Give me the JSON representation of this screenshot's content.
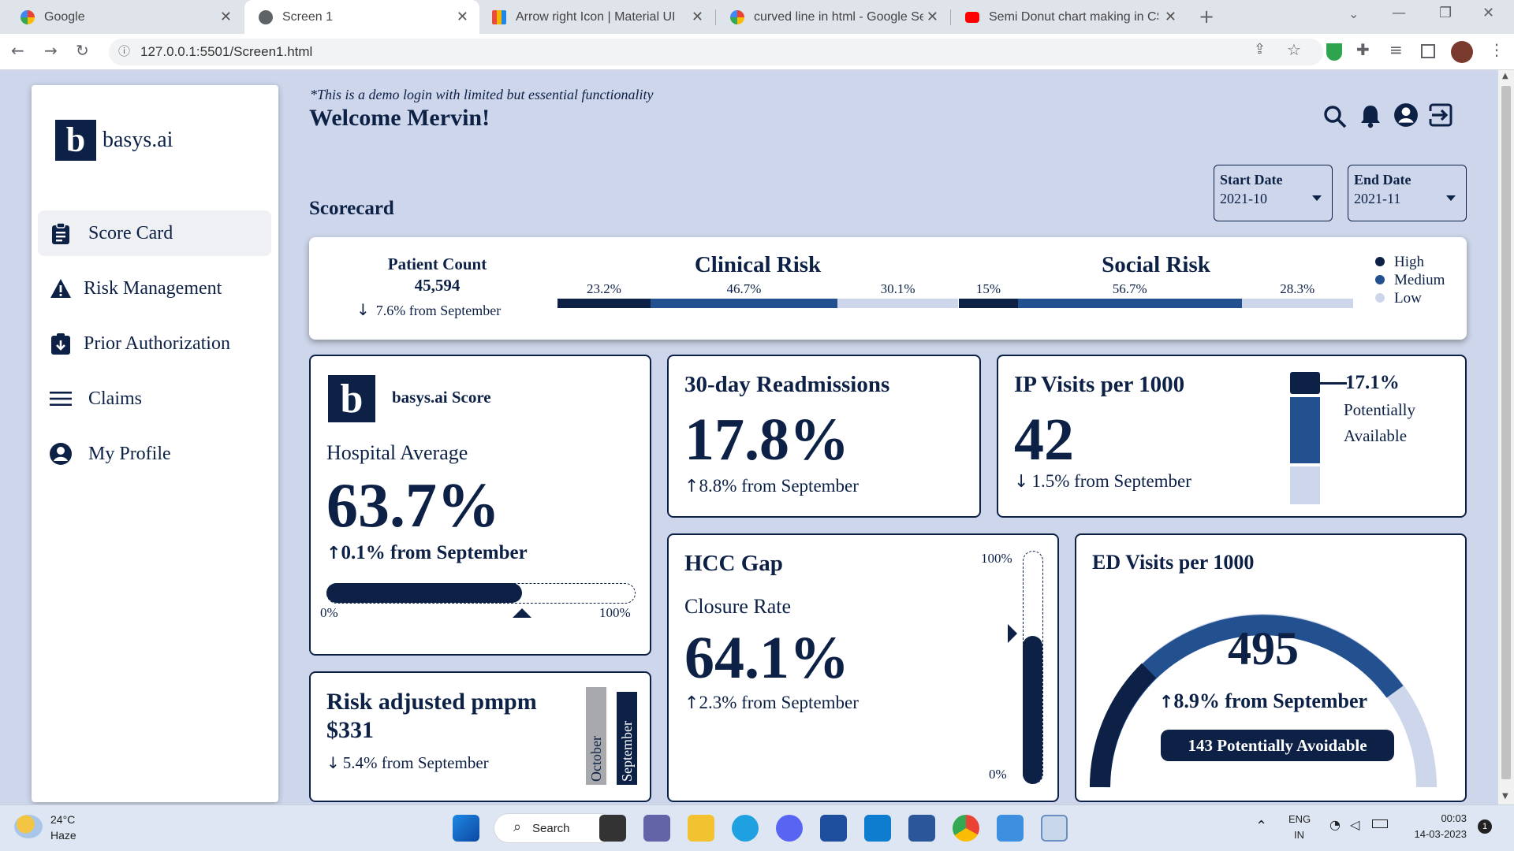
{
  "browser": {
    "tabs": [
      {
        "title": "Google",
        "icon": "google-icon",
        "color": "#4285f4"
      },
      {
        "title": "Screen 1",
        "icon": "globe-icon",
        "color": "#5f6368"
      },
      {
        "title": "Arrow right Icon | Material UI",
        "icon": "mui-icon",
        "color": "#e94b3c"
      },
      {
        "title": "curved line in html - Google Sear",
        "icon": "google-icon",
        "color": "#4285f4"
      },
      {
        "title": "Semi Donut chart making in CSS:",
        "icon": "youtube-icon",
        "color": "#ff0000"
      }
    ],
    "url": "127.0.0.1:5501/Screen1.html"
  },
  "sidebar": {
    "logo_letter": "b",
    "logo_text": "basys.ai",
    "items": [
      {
        "label": "Score Card",
        "icon": "clipboard-icon"
      },
      {
        "label": "Risk Management",
        "icon": "warning-icon"
      },
      {
        "label": "Prior Authorization",
        "icon": "download-doc-icon"
      },
      {
        "label": "Claims",
        "icon": "menu-lines-icon"
      },
      {
        "label": "My Profile",
        "icon": "account-circle-icon"
      }
    ]
  },
  "header": {
    "demo_note": "*This is a demo login with limited but essential functionality",
    "welcome": "Welcome Mervin!",
    "section_title": "Scorecard",
    "start_date_label": "Start Date",
    "start_date_value": "2021-10",
    "end_date_label": "End Date",
    "end_date_value": "2021-11"
  },
  "summary": {
    "patient_count_label": "Patient Count",
    "patient_count_value": "45,594",
    "patient_count_change": "7.6% from September",
    "clinical_title": "Clinical Risk",
    "clinical": [
      {
        "label": "23.2%",
        "value": 23.2
      },
      {
        "label": "46.7%",
        "value": 46.7
      },
      {
        "label": "30.1%",
        "value": 30.1
      }
    ],
    "social_title": "Social Risk",
    "social": [
      {
        "label": "15%",
        "value": 15
      },
      {
        "label": "56.7%",
        "value": 56.7
      },
      {
        "label": "28.3%",
        "value": 28.3
      }
    ],
    "legend": [
      "High",
      "Medium",
      "Low"
    ],
    "colors": {
      "high": "#0d2146",
      "medium": "#23508f",
      "low": "#cdd6ea"
    }
  },
  "score": {
    "logo_letter": "b",
    "title": "basys.ai Score",
    "subtitle": "Hospital Average",
    "value": "63.7%",
    "change": "0.1% from September",
    "progress": 63.7,
    "min_label": "0%",
    "max_label": "100%"
  },
  "pmpm": {
    "title": "Risk adjusted pmpm",
    "value": "$331",
    "change": "5.4% from September",
    "bar_label_1": "October",
    "bar_label_2": "September"
  },
  "readmissions": {
    "title": "30-day Readmissions",
    "value": "17.8%",
    "change": "8.8% from September"
  },
  "ip_visits": {
    "title": "IP Visits per 1000",
    "value": "42",
    "change": "1.5% from September",
    "callout_value": "17.1%",
    "callout_text_1": "Potentially",
    "callout_text_2": "Available"
  },
  "hcc": {
    "title": "HCC Gap",
    "subtitle": "Closure Rate",
    "value": "64.1%",
    "change": "2.3% from September",
    "top_label": "100%",
    "bottom_label": "0%",
    "fill_fraction": 0.641
  },
  "ed_visits": {
    "title": "ED Visits per 1000",
    "value": "495",
    "change": "8.9% from September",
    "badge": "143 Potentially Avoidable"
  },
  "taskbar": {
    "weather_temp": "24°C",
    "weather_text": "Haze",
    "search": "Search",
    "lang_1": "ENG",
    "lang_2": "IN",
    "time": "00:03",
    "date": "14-03-2023",
    "notif": "1"
  }
}
